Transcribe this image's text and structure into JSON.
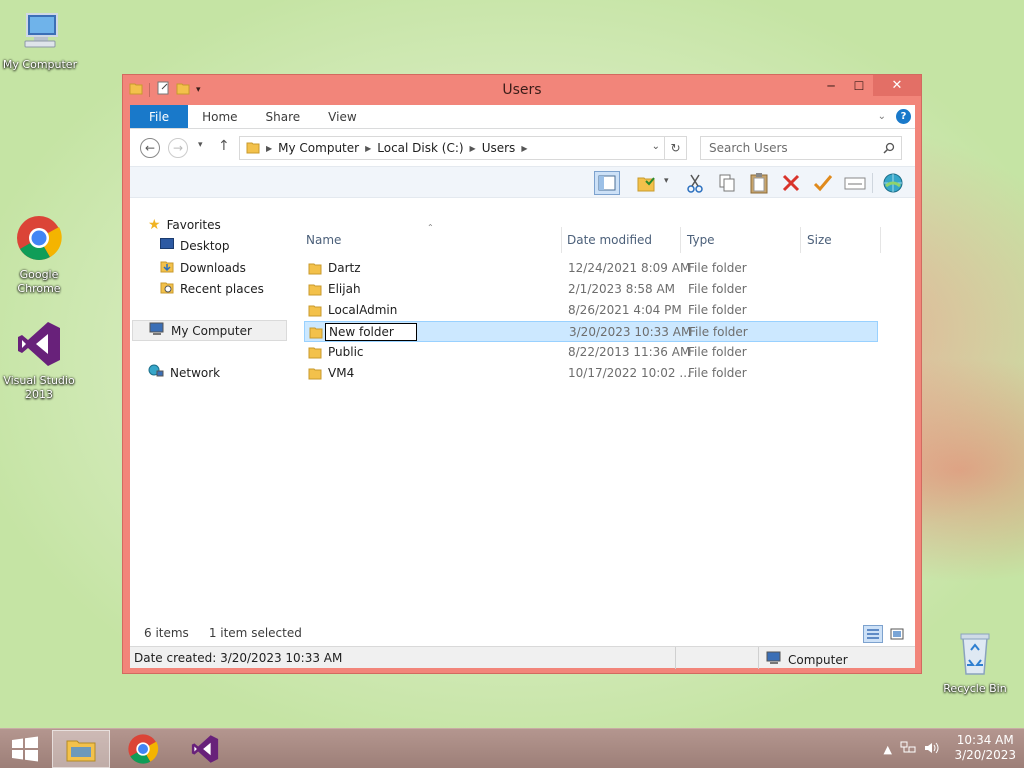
{
  "desktop": {
    "icons": [
      {
        "label": "My Computer"
      },
      {
        "label": "Google Chrome"
      },
      {
        "label": "Visual Studio 2013"
      },
      {
        "label": "Recycle Bin"
      }
    ]
  },
  "window": {
    "title": "Users",
    "controls": {
      "minimize": "─",
      "maximize": "☐",
      "close": "✕"
    },
    "ribbon_tabs": [
      "File",
      "Home",
      "Share",
      "View"
    ],
    "address": {
      "crumbs": [
        "My Computer",
        "Local Disk (C:)",
        "Users"
      ]
    },
    "search": {
      "placeholder": "Search Users"
    },
    "columns": {
      "name": "Name",
      "date": "Date modified",
      "type": "Type",
      "size": "Size"
    },
    "nav": {
      "favorites": "Favorites",
      "desktop": "Desktop",
      "downloads": "Downloads",
      "recent": "Recent places",
      "computer": "My Computer",
      "network": "Network"
    },
    "files": [
      {
        "name": "Dartz",
        "date": "12/24/2021 8:09 AM",
        "type": "File folder"
      },
      {
        "name": "Elijah",
        "date": "2/1/2023 8:58 AM",
        "type": "File folder"
      },
      {
        "name": "LocalAdmin",
        "date": "8/26/2021 4:04 PM",
        "type": "File folder"
      },
      {
        "name": "New folder",
        "date": "3/20/2023 10:33 AM",
        "type": "File folder",
        "renaming": true
      },
      {
        "name": "Public",
        "date": "8/22/2013 11:36 AM",
        "type": "File folder"
      },
      {
        "name": "VM4",
        "date": "10/17/2022 10:02 ...",
        "type": "File folder"
      }
    ],
    "status": {
      "count": "6 items",
      "selected": "1 item selected",
      "detail": "Date created: 3/20/2023 10:33 AM",
      "location": "Computer"
    }
  },
  "taskbar": {
    "time": "10:34 AM",
    "date": "3/20/2023"
  },
  "colors": {
    "accent": "#1979ca",
    "window_frame": "#f2857a",
    "selection": "#cce8ff"
  }
}
